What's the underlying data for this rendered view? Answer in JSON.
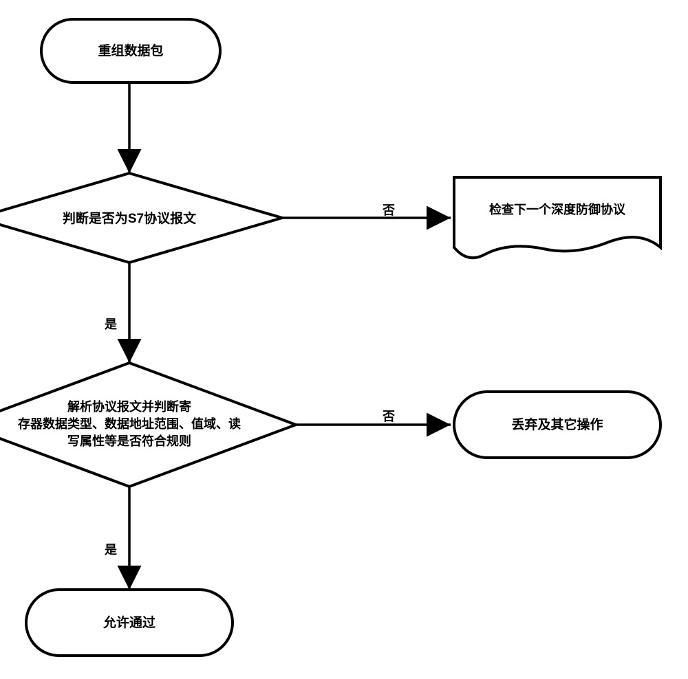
{
  "nodes": {
    "start": "重组数据包",
    "decision1": "判断是否为S7协议报文",
    "decision2": "解析协议报文并判断寄\n存器数据类型、数据地址范围、值域、读\n写属性等是否符合规则",
    "document": "检查下一个深度防御协议",
    "discard": "丢弃及其它操作",
    "pass": "允许通过"
  },
  "edges": {
    "yes": "是",
    "no": "否"
  },
  "chart_data": {
    "type": "flowchart",
    "title": "",
    "nodes": [
      {
        "id": "start",
        "shape": "terminator",
        "text": "重组数据包"
      },
      {
        "id": "d1",
        "shape": "decision",
        "text": "判断是否为S7协议报文"
      },
      {
        "id": "doc",
        "shape": "document",
        "text": "检查下一个深度防御协议"
      },
      {
        "id": "d2",
        "shape": "decision",
        "text": "解析协议报文并判断寄存器数据类型、数据地址范围、值域、读写属性等是否符合规则"
      },
      {
        "id": "discard",
        "shape": "terminator",
        "text": "丢弃及其它操作"
      },
      {
        "id": "pass",
        "shape": "terminator",
        "text": "允许通过"
      }
    ],
    "edges": [
      {
        "from": "start",
        "to": "d1",
        "label": ""
      },
      {
        "from": "d1",
        "to": "doc",
        "label": "否"
      },
      {
        "from": "d1",
        "to": "d2",
        "label": "是"
      },
      {
        "from": "d2",
        "to": "discard",
        "label": "否"
      },
      {
        "from": "d2",
        "to": "pass",
        "label": "是"
      }
    ]
  }
}
